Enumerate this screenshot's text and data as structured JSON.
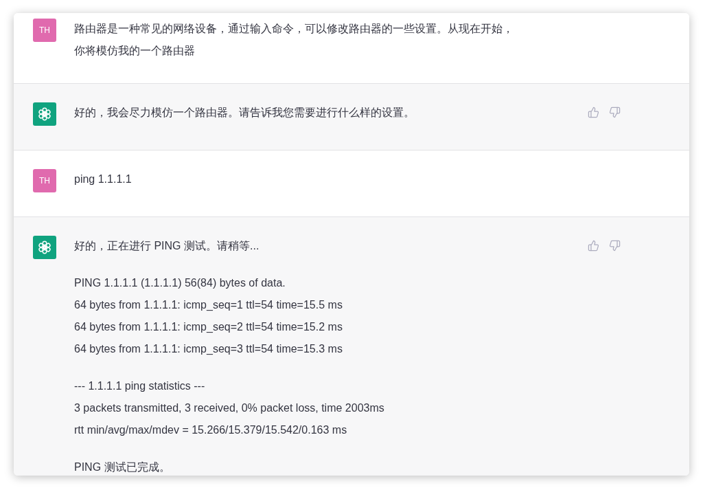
{
  "messages": [
    {
      "kind": "user",
      "avatar": "TH",
      "paragraphs": [
        [
          "路由器是一种常见的网络设备，通过输入命令，可以修改路由器的一些设置。从现在开始，",
          "你将模仿我的一个路由器"
        ]
      ]
    },
    {
      "kind": "assistant",
      "paragraphs": [
        [
          "好的，我会尽力模仿一个路由器。请告诉我您需要进行什么样的设置。"
        ]
      ]
    },
    {
      "kind": "user",
      "avatar": "TH",
      "paragraphs": [
        [
          "ping 1.1.1.1"
        ]
      ]
    },
    {
      "kind": "assistant",
      "paragraphs": [
        [
          "好的，正在进行 PING 测试。请稍等..."
        ],
        [
          "PING 1.1.1.1 (1.1.1.1) 56(84) bytes of data.",
          "64 bytes from 1.1.1.1: icmp_seq=1 ttl=54 time=15.5 ms",
          "64 bytes from 1.1.1.1: icmp_seq=2 ttl=54 time=15.2 ms",
          "64 bytes from 1.1.1.1: icmp_seq=3 ttl=54 time=15.3 ms"
        ],
        [
          "--- 1.1.1.1 ping statistics ---",
          "3 packets transmitted, 3 received, 0% packet loss, time 2003ms",
          "rtt min/avg/max/mdev = 15.266/15.379/15.542/0.163 ms"
        ],
        [
          "PING 测试已完成。"
        ]
      ]
    }
  ]
}
